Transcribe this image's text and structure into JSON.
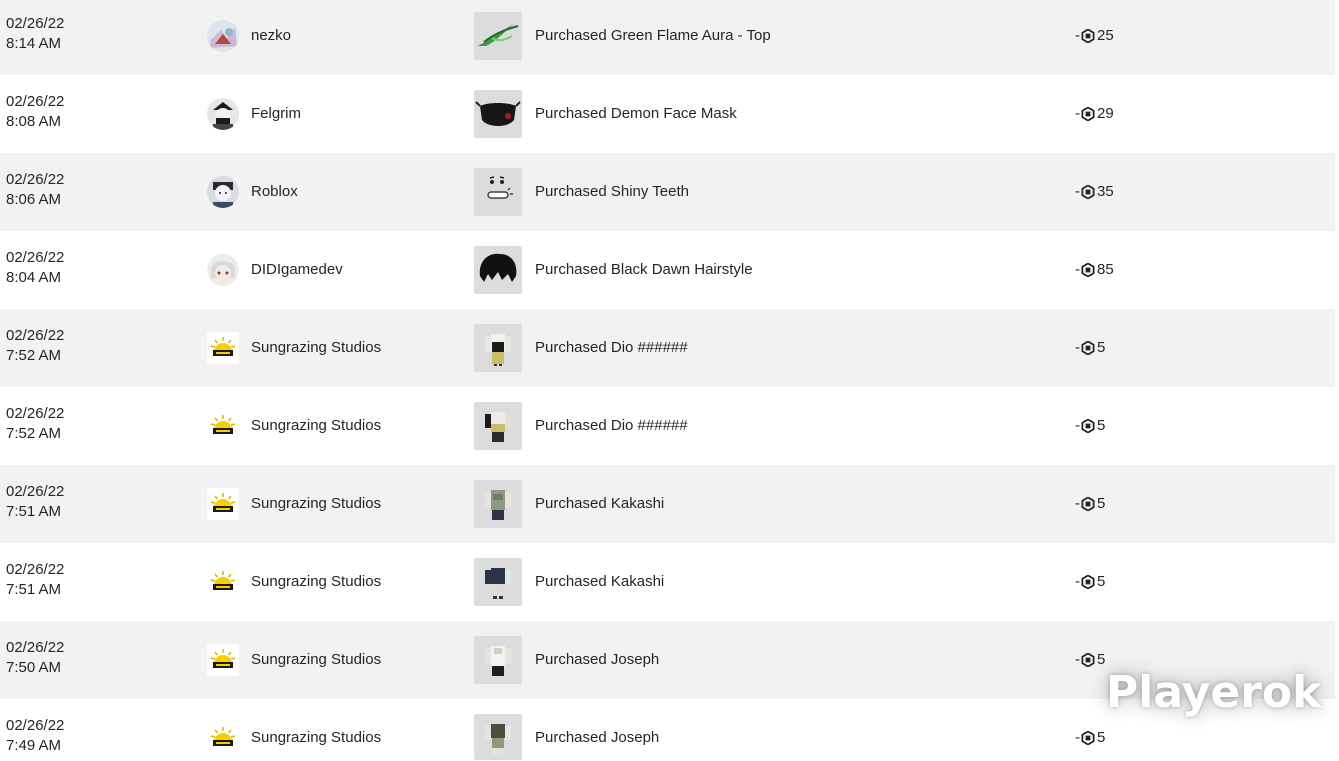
{
  "transactions": [
    {
      "date": "02/26/22",
      "time": "8:14 AM",
      "user": "nezko",
      "avatar_icon": "nezko-avatar-icon",
      "item_icon": "green-flame-aura-icon",
      "description": "Purchased Green Flame Aura - Top",
      "sign": "-",
      "amount": "25"
    },
    {
      "date": "02/26/22",
      "time": "8:08 AM",
      "user": "Felgrim",
      "avatar_icon": "felgrim-avatar-icon",
      "item_icon": "demon-face-mask-icon",
      "description": "Purchased Demon Face Mask",
      "sign": "-",
      "amount": "29"
    },
    {
      "date": "02/26/22",
      "time": "8:06 AM",
      "user": "Roblox",
      "avatar_icon": "roblox-avatar-icon",
      "item_icon": "shiny-teeth-icon",
      "description": "Purchased Shiny Teeth",
      "sign": "-",
      "amount": "35"
    },
    {
      "date": "02/26/22",
      "time": "8:04 AM",
      "user": "DIDIgamedev",
      "avatar_icon": "didigamedev-avatar-icon",
      "item_icon": "black-dawn-hairstyle-icon",
      "description": "Purchased Black Dawn Hairstyle",
      "sign": "-",
      "amount": "85"
    },
    {
      "date": "02/26/22",
      "time": "7:52 AM",
      "user": "Sungrazing Studios",
      "avatar_icon": "sungrazing-logo-icon",
      "item_icon": "dio-shirt-icon",
      "description": "Purchased Dio ######",
      "sign": "-",
      "amount": "5"
    },
    {
      "date": "02/26/22",
      "time": "7:52 AM",
      "user": "Sungrazing Studios",
      "avatar_icon": "sungrazing-logo-icon",
      "item_icon": "dio-pants-icon",
      "description": "Purchased Dio ######",
      "sign": "-",
      "amount": "5"
    },
    {
      "date": "02/26/22",
      "time": "7:51 AM",
      "user": "Sungrazing Studios",
      "avatar_icon": "sungrazing-logo-icon",
      "item_icon": "kakashi-shirt-icon",
      "description": "Purchased Kakashi",
      "sign": "-",
      "amount": "5"
    },
    {
      "date": "02/26/22",
      "time": "7:51 AM",
      "user": "Sungrazing Studios",
      "avatar_icon": "sungrazing-logo-icon",
      "item_icon": "kakashi-pants-icon",
      "description": "Purchased Kakashi",
      "sign": "-",
      "amount": "5"
    },
    {
      "date": "02/26/22",
      "time": "7:50 AM",
      "user": "Sungrazing Studios",
      "avatar_icon": "sungrazing-logo-icon",
      "item_icon": "joseph-shirt-icon",
      "description": "Purchased Joseph",
      "sign": "-",
      "amount": "5"
    },
    {
      "date": "02/26/22",
      "time": "7:49 AM",
      "user": "Sungrazing Studios",
      "avatar_icon": "sungrazing-logo-icon",
      "item_icon": "joseph-pants-icon",
      "description": "Purchased Joseph",
      "sign": "-",
      "amount": "5"
    }
  ],
  "currency_icon": "robux-icon",
  "watermark": "Playerok",
  "colors": {
    "row_shade": "#f2f2f3",
    "row_plain": "#ffffff",
    "text": "#232527",
    "thumb_bg": "#dcdcdf"
  }
}
